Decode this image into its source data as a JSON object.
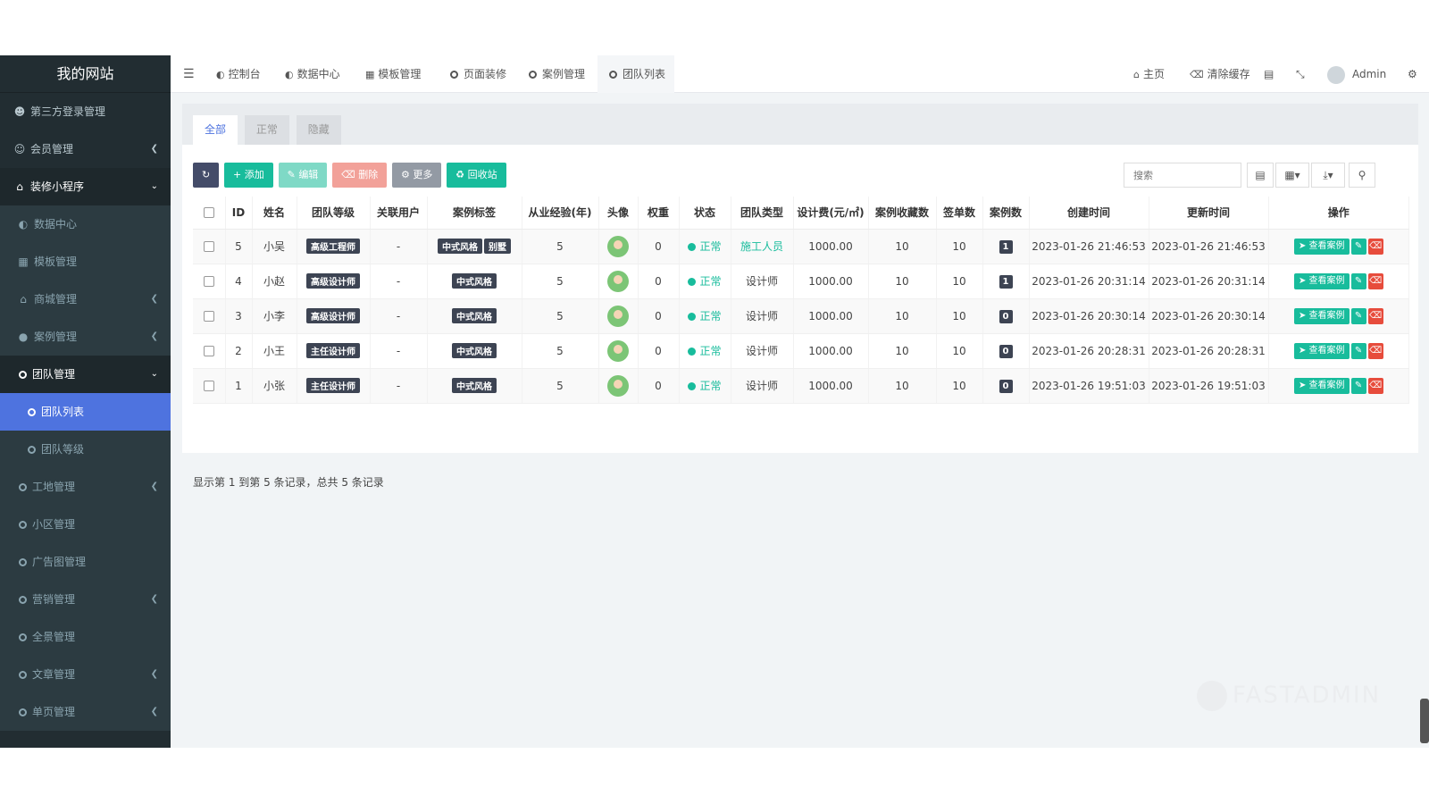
{
  "sidebar": {
    "logo": "我的网站",
    "items": [
      {
        "label": "第三方登录管理"
      },
      {
        "label": "会员管理"
      },
      {
        "label": "装修小程序"
      },
      {
        "label": "数据中心"
      },
      {
        "label": "模板管理"
      },
      {
        "label": "商城管理"
      },
      {
        "label": "案例管理"
      },
      {
        "label": "团队管理"
      },
      {
        "label": "团队列表"
      },
      {
        "label": "团队等级"
      },
      {
        "label": "工地管理"
      },
      {
        "label": "小区管理"
      },
      {
        "label": "广告图管理"
      },
      {
        "label": "营销管理"
      },
      {
        "label": "全景管理"
      },
      {
        "label": "文章管理"
      },
      {
        "label": "单页管理"
      }
    ]
  },
  "topnav": {
    "tabs": [
      "控制台",
      "数据中心",
      "模板管理",
      "页面装修",
      "案例管理",
      "团队列表"
    ],
    "home": "主页",
    "clear_cache": "清除缓存",
    "user": "Admin"
  },
  "tabs": [
    "全部",
    "正常",
    "隐藏"
  ],
  "toolbar": {
    "add": "添加",
    "edit": "编辑",
    "delete": "删除",
    "more": "更多",
    "recycle": "回收站",
    "search_placeholder": "搜索"
  },
  "table": {
    "headers": [
      "ID",
      "姓名",
      "团队等级",
      "关联用户",
      "案例标签",
      "从业经验(年)",
      "头像",
      "权重",
      "状态",
      "团队类型",
      "设计费(元/㎡)",
      "案例收藏数",
      "签单数",
      "案例数",
      "创建时间",
      "更新时间",
      "操作"
    ],
    "view_label": "查看案例",
    "rows": [
      {
        "id": "5",
        "name": "小吴",
        "level": "高级工程师",
        "user": "-",
        "tags": [
          "中式风格",
          "别墅"
        ],
        "exp": "5",
        "weight": "0",
        "status": "正常",
        "type": "施工人员",
        "fee": "1000.00",
        "fav": "10",
        "sign": "10",
        "cases": "1",
        "created": "2023-01-26 21:46:53",
        "updated": "2023-01-26 21:46:53"
      },
      {
        "id": "4",
        "name": "小赵",
        "level": "高级设计师",
        "user": "-",
        "tags": [
          "中式风格"
        ],
        "exp": "5",
        "weight": "0",
        "status": "正常",
        "type": "设计师",
        "fee": "1000.00",
        "fav": "10",
        "sign": "10",
        "cases": "1",
        "created": "2023-01-26 20:31:14",
        "updated": "2023-01-26 20:31:14"
      },
      {
        "id": "3",
        "name": "小李",
        "level": "高级设计师",
        "user": "-",
        "tags": [
          "中式风格"
        ],
        "exp": "5",
        "weight": "0",
        "status": "正常",
        "type": "设计师",
        "fee": "1000.00",
        "fav": "10",
        "sign": "10",
        "cases": "0",
        "created": "2023-01-26 20:30:14",
        "updated": "2023-01-26 20:30:14"
      },
      {
        "id": "2",
        "name": "小王",
        "level": "主任设计师",
        "user": "-",
        "tags": [
          "中式风格"
        ],
        "exp": "5",
        "weight": "0",
        "status": "正常",
        "type": "设计师",
        "fee": "1000.00",
        "fav": "10",
        "sign": "10",
        "cases": "0",
        "created": "2023-01-26 20:28:31",
        "updated": "2023-01-26 20:28:31"
      },
      {
        "id": "1",
        "name": "小张",
        "level": "主任设计师",
        "user": "-",
        "tags": [
          "中式风格"
        ],
        "exp": "5",
        "weight": "0",
        "status": "正常",
        "type": "设计师",
        "fee": "1000.00",
        "fav": "10",
        "sign": "10",
        "cases": "0",
        "created": "2023-01-26 19:51:03",
        "updated": "2023-01-26 19:51:03"
      }
    ]
  },
  "footer_info": "显示第 1 到第 5 条记录，总共 5 条记录",
  "watermark": "FASTADMIN",
  "colors": {
    "accent": "#4e73df",
    "green": "#18bc9c",
    "red": "#e74c3c",
    "sidebar": "#222d32"
  }
}
